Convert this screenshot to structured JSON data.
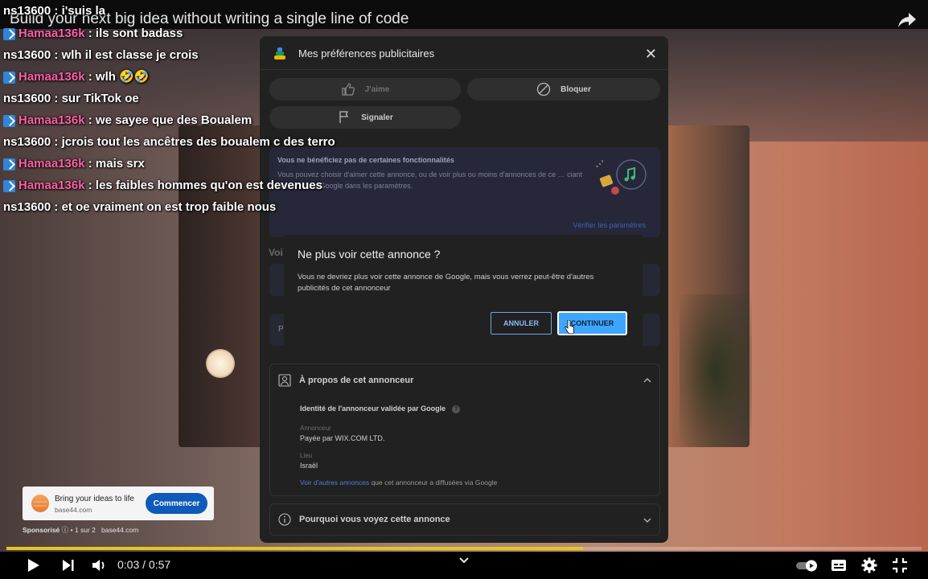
{
  "video": {
    "title": "Build your next big idea without writing a single line of code",
    "time_current": "0:03",
    "time_total": "0:57",
    "time_separator": "/",
    "progress_fraction": 0.63
  },
  "chat": [
    {
      "user": "ns13600",
      "text": "i'suis la",
      "badge": false,
      "user_color": "#ffffff"
    },
    {
      "user": "Hamaa136k",
      "text": "ils sont badass",
      "badge": true,
      "user_color": "#ff5fa6"
    },
    {
      "user": "ns13600",
      "text": "wlh il est classe je crois",
      "badge": false,
      "user_color": "#ffffff"
    },
    {
      "user": "Hamaa136k",
      "text": "wlh 🤣🤣",
      "badge": true,
      "user_color": "#ff5fa6"
    },
    {
      "user": "ns13600",
      "text": "sur TikTok oe",
      "badge": false,
      "user_color": "#ffffff"
    },
    {
      "user": "Hamaa136k",
      "text": "we sayee que des Boualem",
      "badge": true,
      "user_color": "#ff5fa6"
    },
    {
      "user": "ns13600",
      "text": "jcrois tout les ancêtres des boualem c des terro",
      "badge": false,
      "user_color": "#ffffff"
    },
    {
      "user": "Hamaa136k",
      "text": "mais srx",
      "badge": true,
      "user_color": "#ff5fa6"
    },
    {
      "user": "Hamaa136k",
      "text": "les faibles hommes qu'on est devenues",
      "badge": true,
      "user_color": "#ff5fa6"
    },
    {
      "user": "ns13600",
      "text": "et oe vraiment on est trop faible nous",
      "badge": false,
      "user_color": "#ffffff"
    }
  ],
  "panel": {
    "title": "Mes préférences publicitaires",
    "like_label": "J'aime",
    "block_label": "Bloquer",
    "report_label": "Signaler",
    "info_title": "Vous ne bénéficiez pas de certaines fonctionnalités",
    "info_text": "Vous pouvez choisir d'aimer cette annonce, ou de voir plus ou moins d'annonces de ce … ciant des services Google dans les paramètres.",
    "info_link": "Vérifier les paramètres",
    "partial_heading": "Voi",
    "partial_row_letter": "P",
    "about_title": "À propos de cet annonceur",
    "verified_label": "Identité de l'annonceur validée par Google",
    "help_glyph": "?",
    "advertiser_label": "Annonceur",
    "advertiser_value": "Payée par WIX.COM LTD.",
    "location_label": "Lieu",
    "location_value": "Israël",
    "other_ads_link": "Voir d'autres annonces",
    "other_ads_suffix": " que cet annonceur a diffusées via Google",
    "why_title": "Pourquoi vous voyez cette annonce"
  },
  "dialog": {
    "title": "Ne plus voir cette annonce ?",
    "body": "Vous ne devriez plus voir cette annonce de Google, mais vous verrez peut-être d'autres publicités de cet annonceur",
    "cancel_label": "ANNULER",
    "continue_label": "CONTINUER"
  },
  "ad": {
    "headline": "Bring your ideas to life",
    "domain": "base44.com",
    "cta": "Commencer",
    "sponsored": "Sponsorisé",
    "info_glyph": "ⓘ",
    "position": "• 1 sur 2",
    "meta_domain": "base44.com"
  },
  "colors": {
    "accent_blue": "#3ea6ff",
    "progress": "#e8c423",
    "chat_pink": "#ff5fa6"
  }
}
